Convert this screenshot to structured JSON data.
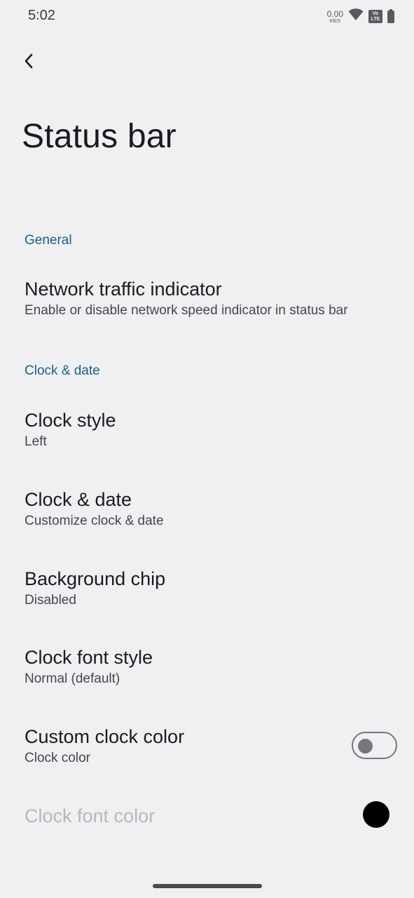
{
  "status_bar": {
    "time": "5:02",
    "net_speed": "0.00",
    "net_unit": "KB/S",
    "volte_top": "Vo",
    "volte_bottom": "LTE",
    "icons": [
      "wifi-icon",
      "volte-icon",
      "battery-icon"
    ]
  },
  "page": {
    "title": "Status bar"
  },
  "sections": {
    "general": {
      "header": "General",
      "network": {
        "title": "Network traffic indicator",
        "summary": "Enable or disable network speed indicator in status bar"
      }
    },
    "clock": {
      "header": "Clock & date",
      "clock_style": {
        "title": "Clock style",
        "summary": "Left"
      },
      "clock_date": {
        "title": "Clock & date",
        "summary": "Customize clock & date"
      },
      "background_chip": {
        "title": "Background chip",
        "summary": "Disabled"
      },
      "font_style": {
        "title": "Clock font style",
        "summary": "Normal (default)"
      },
      "custom_color": {
        "title": "Custom clock color",
        "summary": "Clock color",
        "enabled": false
      },
      "font_color": {
        "title": "Clock font color",
        "color": "#000000",
        "disabled": true
      }
    }
  },
  "colors": {
    "accent": "#1d5f7e",
    "background": "#f0f0f3"
  }
}
